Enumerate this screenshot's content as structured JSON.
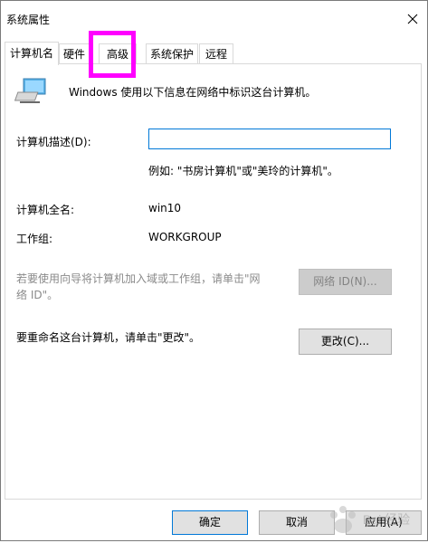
{
  "window": {
    "title": "系统属性"
  },
  "tabs": [
    {
      "label": "计算机名",
      "selected": true
    },
    {
      "label": "硬件",
      "selected": false
    },
    {
      "label": "高级",
      "selected": false
    },
    {
      "label": "系统保护",
      "selected": false
    },
    {
      "label": "远程",
      "selected": false
    }
  ],
  "panel": {
    "intro_text": "Windows 使用以下信息在网络中标识这台计算机。",
    "description_label": "计算机描述(D):",
    "description_value": "",
    "example_text": "例如: \"书房计算机\"或\"美玲的计算机\"。",
    "full_name_label": "计算机全名:",
    "full_name_value": "win10",
    "workgroup_label": "工作组:",
    "workgroup_value": "WORKGROUP",
    "network_id_text": "若要使用向导将计算机加入域或工作组，请单击\"网络 ID\"。",
    "network_id_text_line1": "若要使用向导将计算机加入域或工作组，请单击\"网",
    "network_id_text_line2": "络 ID\"。",
    "network_id_button": "网络 ID(N)...",
    "rename_text": "要重命名这台计算机，请单击\"更改\"。",
    "change_button": "更改(C)..."
  },
  "footer": {
    "ok_button": "确定",
    "cancel_button": "取消",
    "apply_button": "应用(A)"
  },
  "watermark": {
    "text": "Bai 经验"
  },
  "colors": {
    "highlight_box": "#ff00ff",
    "focus_border": "#0078d7"
  }
}
